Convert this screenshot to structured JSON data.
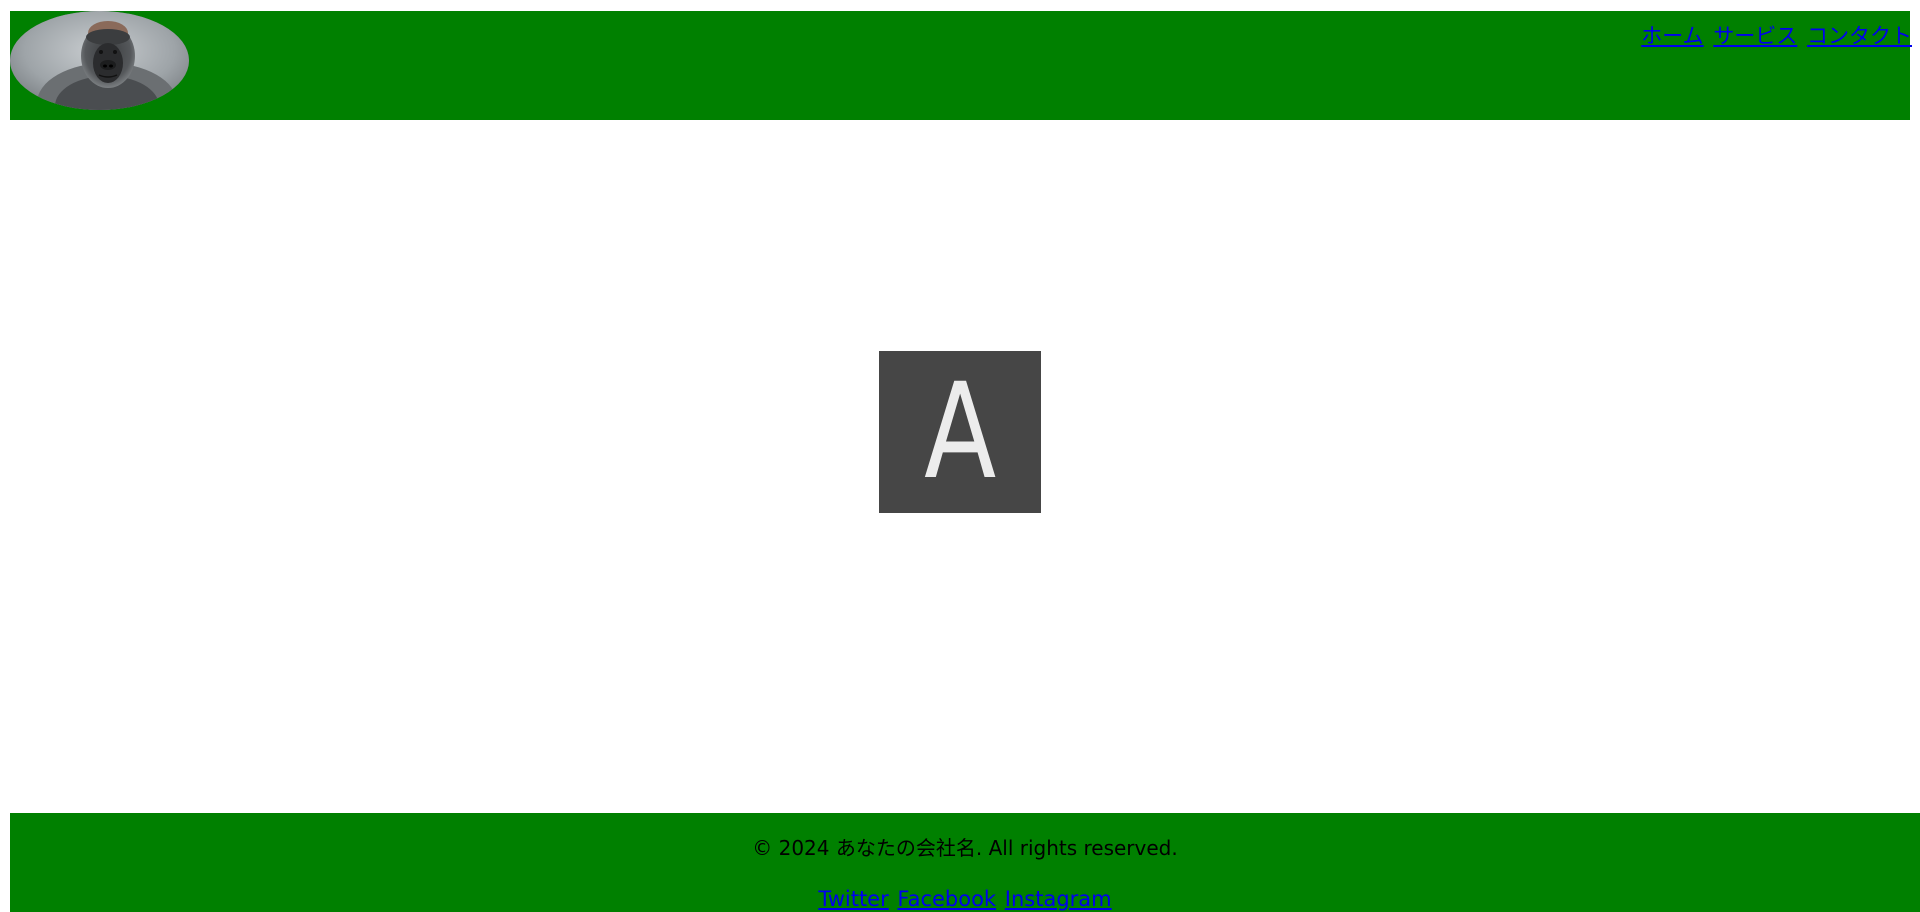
{
  "header": {
    "background_color": "#008000",
    "logo": {
      "icon": "gorilla-photo"
    },
    "nav": [
      {
        "label": "ホーム"
      },
      {
        "label": "サービス"
      },
      {
        "label": "コンタクト"
      }
    ]
  },
  "main": {
    "placeholder": {
      "letter": "A",
      "background_color": "#464646",
      "text_color": "#ececec"
    }
  },
  "footer": {
    "background_color": "#008000",
    "copyright": "© 2024 あなたの会社名. All rights reserved.",
    "social": [
      {
        "label": "Twitter"
      },
      {
        "label": "Facebook"
      },
      {
        "label": "Instagram"
      }
    ]
  },
  "colors": {
    "link": "#0000ee",
    "accent_green": "#008000"
  }
}
